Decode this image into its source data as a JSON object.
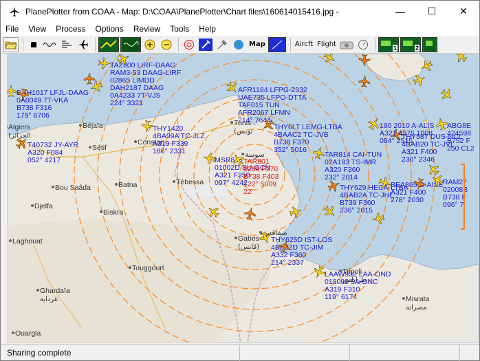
{
  "window": {
    "title": "PlanePlotter from COAA - Map: D:\\COAA\\PlanePlotter\\Chart files\\160614015416.jpg -",
    "minimize": "—",
    "maximize": "☐",
    "close": "✕"
  },
  "menu": [
    "File",
    "View",
    "Process",
    "Options",
    "Review",
    "Tools",
    "Help"
  ],
  "toolbar": {
    "map_label": "Map",
    "aircraft_label": "Aircft",
    "flight_label": "Flight",
    "badge_1": "1",
    "badge_2": "2"
  },
  "status": {
    "text": "Sharing complete"
  },
  "colors": {
    "aircraft_text": "#1a1ad6",
    "highlight_text": "#e01818",
    "range_ring": "#ff8a1a",
    "plane_yellow": "#ffd21a",
    "plane_orange": "#f07d18",
    "sea": "#bcd3e6",
    "land": "#e9e6dd"
  },
  "places": [
    {
      "name": "Algiers",
      "ar": "(الجزائر"
    },
    {
      "name": "Béjaïa"
    },
    {
      "name": "Sétif"
    },
    {
      "name": "Constan"
    },
    {
      "name": "Batna"
    },
    {
      "name": "Tébessa"
    },
    {
      "name": "Biskra"
    },
    {
      "name": "Bou Saâda"
    },
    {
      "name": "Djelfa"
    },
    {
      "name": "Laghouat"
    },
    {
      "name": "Ghardaïa",
      "ar": "غرداية"
    },
    {
      "name": "Touggourt"
    },
    {
      "name": "Ouargla"
    },
    {
      "name": "Gabes",
      "ar": "(قابس)"
    },
    {
      "name": "Tripoli",
      "ar": "طرابلس"
    },
    {
      "name": "Misrata",
      "ar": "مصراته"
    },
    {
      "name": "Tunis",
      "ar": "(تونس"
    },
    {
      "name": "سوسة"
    },
    {
      "name": "صفاقس"
    }
  ],
  "aircraft": [
    {
      "lines": [
        "DAH1017 LFJL-DAAG",
        "0A0049 7T-VKA",
        "B738 F316",
        "179° 6706"
      ],
      "hl": false
    },
    {
      "lines": [
        "T40732 JY-AYR",
        "A320 F084",
        "052° 4217"
      ],
      "hl": false
    },
    {
      "lines": [
        "TAZ800 LIRF-DAAG",
        "RAM3-53 DAAG-LIRF",
        "02865 LIMDD",
        "DAH2187 DAAG",
        "0A4233 7T-VJS",
        "224° 3321"
      ],
      "hl": false
    },
    {
      "lines": [
        "AFR1184 LFPG-2332",
        "UAE735 LFPO-DTTA",
        "TAF015 TUN",
        "AFR2067 LFMN",
        "214° 7644"
      ],
      "hl": false
    },
    {
      "lines": [
        "THY1420",
        "4BA99A TC-JLZ",
        "A319 F339",
        "186° 2331"
      ],
      "hl": false
    },
    {
      "lines": [
        "THY6LT LEMG-LTBA",
        "4BAAC2 TC-JVB",
        "B738 F370",
        "352° 5016"
      ],
      "hl": false
    },
    {
      "lines": [
        "MSR848",
        "01002D SU-GCN",
        "A321 F350",
        "097° 4242"
      ],
      "hl": false
    },
    {
      "lines": [
        "TAR801",
        "0288 F270",
        "B738 F403",
        "122° 5009",
        "22"
      ],
      "hl": true
    },
    {
      "lines": [
        "TAR814 CAI-TUN",
        "02A193 TS-IMR",
        "A320 F360",
        "232° 2014"
      ],
      "hl": false
    },
    {
      "lines": [
        "THY629 HECA-LTBA",
        "4BAB2A TC-JHL",
        "B739 F360",
        "236° 2015"
      ],
      "hl": false
    },
    {
      "lines": [
        "BEA865 D-AISE",
        "A321 F400",
        "278° 2030"
      ],
      "hl": false
    },
    {
      "lines": [
        "THY625D IST-LOS",
        "4BA92D TC-JIM",
        "A332 F360",
        "214° 2337"
      ],
      "hl": false
    },
    {
      "lines": [
        "LAAW932 LAA-OND",
        "018099 5A-ONC",
        "A319 F310",
        "119° 6174"
      ],
      "hl": false
    },
    {
      "lines": [
        "THY58T DUS-NCL",
        "4BAB20 TC-JVL",
        "A321 F400",
        "230° 2346"
      ],
      "hl": false
    },
    {
      "lines": [
        "RAM27",
        "02008B",
        "B738 F",
        "096° 7"
      ],
      "hl": false
    },
    {
      "lines": [
        "ABG8E",
        "424598",
        "B752 F",
        "250 CL2"
      ],
      "hl": false
    },
    {
      "lines": [
        "190 2010 A-ALIS",
        "A321 4575 1008",
        "084° 2515"
      ],
      "hl": false
    }
  ]
}
